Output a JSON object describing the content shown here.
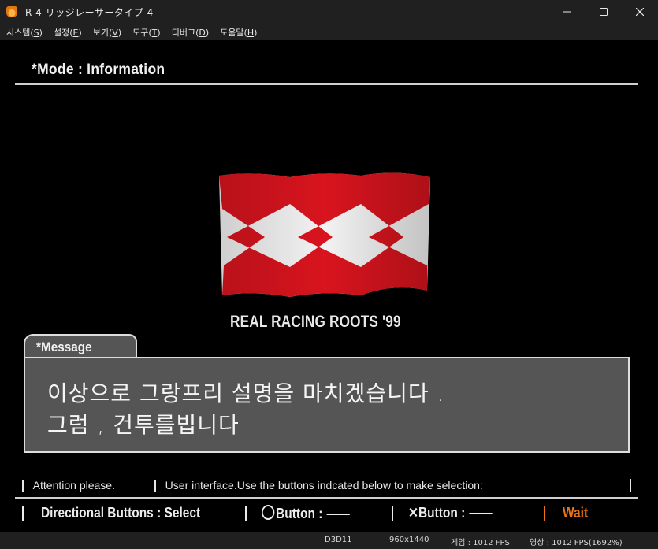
{
  "window": {
    "title": "R 4   リッジレーサータイプ 4",
    "controls": [
      "minimize",
      "maximize",
      "close"
    ]
  },
  "menu": [
    {
      "label": "시스템",
      "accel": "S"
    },
    {
      "label": "설정",
      "accel": "E"
    },
    {
      "label": "보기",
      "accel": "V"
    },
    {
      "label": "도구",
      "accel": "T"
    },
    {
      "label": "디버그",
      "accel": "D"
    },
    {
      "label": "도움말",
      "accel": "H"
    }
  ],
  "game": {
    "mode_title": "*Mode : Information",
    "logo_caption": "REAL RACING ROOTS '99",
    "logo_colors": {
      "red": "#d8141e",
      "white": "#f2f2f2"
    },
    "message_tab": "*Message",
    "message_lines": [
      "이상으로 그랑프리 설명을 마치겠습니다 .",
      "그럼 ,  건투를빕니다"
    ],
    "attention": {
      "left": "Attention please.",
      "right": "User interface.Use the buttons indcated below to make selection:"
    },
    "controls": {
      "directional": "Directional Buttons : Select",
      "circle": "Button :",
      "cross": "Button :",
      "wait": "Wait"
    },
    "accent_color": "#e8731a"
  },
  "status": {
    "renderer": "D3D11",
    "resolution": "960x1440",
    "game_fps": "게임 : 1012 FPS",
    "video_fps": "영상 : 1012 FPS(1692%)"
  }
}
